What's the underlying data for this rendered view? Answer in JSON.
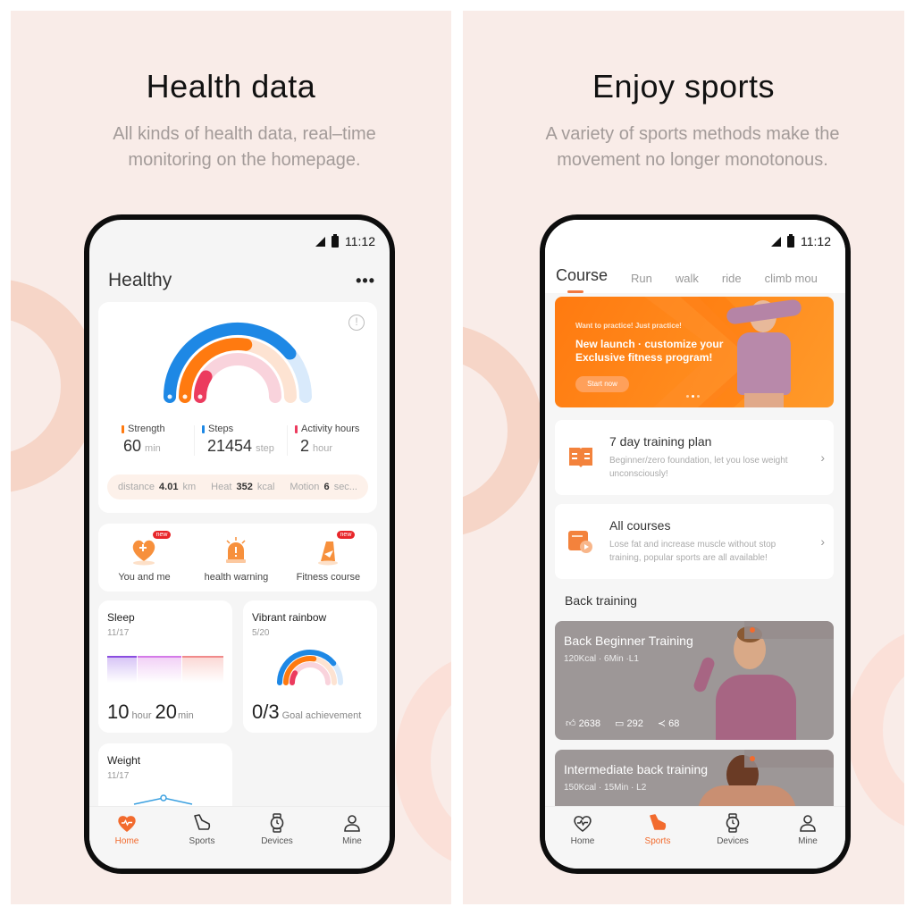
{
  "panels": {
    "left": {
      "title": "Health data",
      "subtitle": "All kinds of health data, real–time monitoring on the homepage."
    },
    "right": {
      "title": "Enjoy sports",
      "subtitle": "A variety of sports methods make the movement no longer monotonous."
    }
  },
  "colors": {
    "accent": "#f26b2e",
    "background": "#f9ece8",
    "steps_blue": "#1e88e5",
    "strength_orange": "#ff7a10",
    "activity_red": "#ec3b5e"
  },
  "health_screen": {
    "status": {
      "time": "11:12"
    },
    "title": "Healthy",
    "more_icon": "ellipsis-icon",
    "rings": {
      "steps_progress": 0.78,
      "strength_progress": 0.55,
      "activity_progress": 0.18
    },
    "stats": [
      {
        "label": "Strength",
        "value": "60",
        "unit": "min",
        "color": "#ff7a10"
      },
      {
        "label": "Steps",
        "value": "21454",
        "unit": "step",
        "color": "#1e88e5"
      },
      {
        "label": "Activity hours",
        "value": "2",
        "unit": "hour",
        "color": "#ec3b5e"
      }
    ],
    "summary": {
      "distance_label": "distance",
      "distance_value": "4.01",
      "distance_unit": "km",
      "heat_label": "Heat",
      "heat_value": "352",
      "heat_unit": "kcal",
      "motion_label": "Motion",
      "motion_value": "6",
      "motion_unit": "sec..."
    },
    "quick_links": [
      {
        "label": "You and me",
        "badge": "new",
        "icon": "heart-plus-icon"
      },
      {
        "label": "health warning",
        "badge": "",
        "icon": "alarm-warning-icon"
      },
      {
        "label": "Fitness course",
        "badge": "new",
        "icon": "fitness-icon"
      }
    ],
    "sleep": {
      "title": "Sleep",
      "date": "11/17",
      "hours": "10",
      "hours_unit": "hour",
      "minutes": "20",
      "minutes_unit": "min"
    },
    "rainbow": {
      "title": "Vibrant rainbow",
      "date": "5/20",
      "achieved": "0/3",
      "label": "Goal achievement"
    },
    "weight": {
      "title": "Weight",
      "date": "11/17"
    },
    "tabs": [
      {
        "label": "Home",
        "icon": "heart-pulse-icon",
        "active": true
      },
      {
        "label": "Sports",
        "icon": "shoe-icon",
        "active": false
      },
      {
        "label": "Devices",
        "icon": "watch-icon",
        "active": false
      },
      {
        "label": "Mine",
        "icon": "person-icon",
        "active": false
      }
    ]
  },
  "sports_screen": {
    "status": {
      "time": "11:12"
    },
    "course_tabs": [
      "Course",
      "Run",
      "walk",
      "ride",
      "climb mou"
    ],
    "banner": {
      "kicker": "Want to practice! Just practice!",
      "headline_1": "New launch · customize your",
      "headline_2": "Exclusive fitness program!",
      "cta": "Start now",
      "page_index": 2,
      "page_count": 3
    },
    "plans": [
      {
        "title": "7 day training plan",
        "subtitle": "Beginner/zero foundation, let you lose weight unconsciously!",
        "icon": "book-icon"
      },
      {
        "title": "All courses",
        "subtitle": "Lose fat and increase muscle without stop training, popular sports are all available!",
        "icon": "video-course-icon"
      }
    ],
    "section_title": "Back training",
    "videos": [
      {
        "title": "Back Beginner Training",
        "meta": "120Kcal · 6Min ·L1",
        "likes": "2638",
        "comments": "292",
        "shares": "68"
      },
      {
        "title": "Intermediate back training",
        "meta": "150Kcal · 15Min · L2"
      }
    ],
    "tabs": [
      {
        "label": "Home",
        "icon": "heart-pulse-icon",
        "active": false
      },
      {
        "label": "Sports",
        "icon": "shoe-icon",
        "active": true
      },
      {
        "label": "Devices",
        "icon": "watch-icon",
        "active": false
      },
      {
        "label": "Mine",
        "icon": "person-icon",
        "active": false
      }
    ]
  }
}
